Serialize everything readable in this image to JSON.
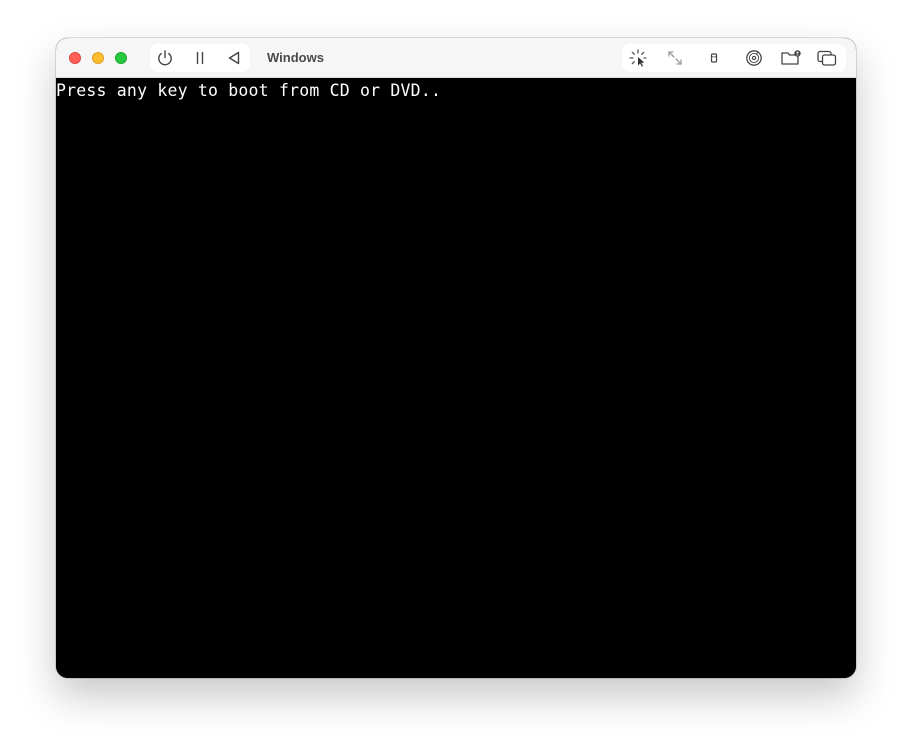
{
  "window": {
    "title": "Windows"
  },
  "toolbar": {
    "left_buttons": [
      {
        "icon": "power-icon"
      },
      {
        "icon": "pause-icon"
      },
      {
        "icon": "back-triangle-icon"
      }
    ],
    "right_buttons": [
      {
        "icon": "capture-cursor-icon"
      },
      {
        "icon": "resize-arrows-icon"
      },
      {
        "icon": "usb-icon"
      },
      {
        "icon": "cd-dvd-icon"
      },
      {
        "icon": "shared-folder-icon"
      },
      {
        "icon": "windows-stack-icon"
      }
    ]
  },
  "screen": {
    "console_text": "Press any key to boot from CD or DVD.."
  },
  "colors": {
    "close": "#ff5f57",
    "minimize": "#febc2e",
    "zoom": "#28c840",
    "screen_bg": "#000000",
    "console_text": "#ffffff"
  }
}
